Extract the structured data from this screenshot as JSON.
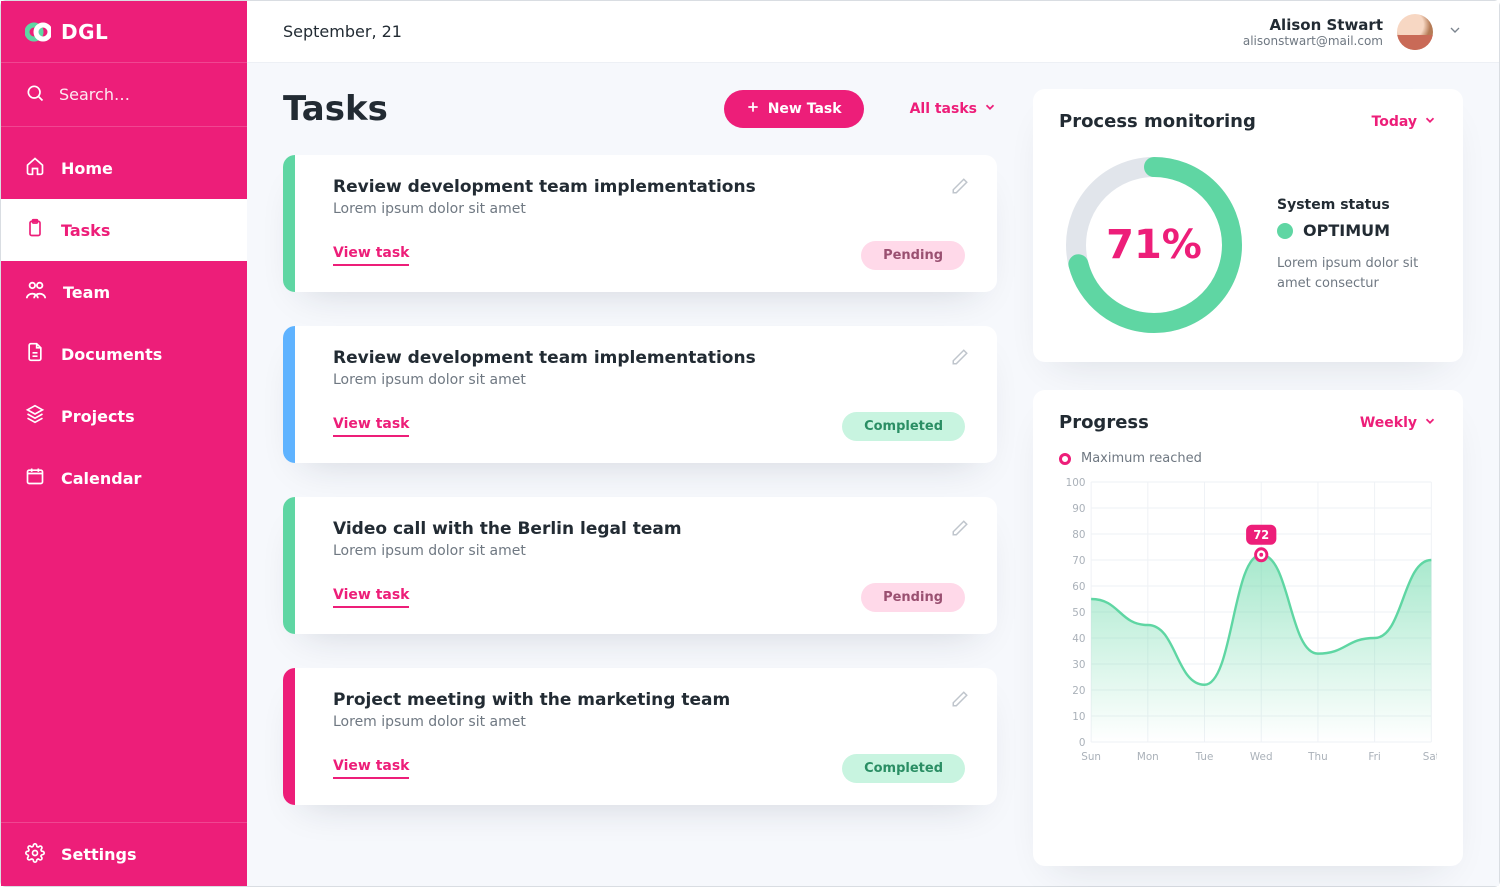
{
  "brand": {
    "name": "DGL"
  },
  "sidebar": {
    "search_placeholder": "Search…",
    "items": [
      {
        "id": "home",
        "label": "Home",
        "active": false
      },
      {
        "id": "tasks",
        "label": "Tasks",
        "active": true
      },
      {
        "id": "team",
        "label": "Team",
        "active": false
      },
      {
        "id": "documents",
        "label": "Documents",
        "active": false
      },
      {
        "id": "projects",
        "label": "Projects",
        "active": false
      },
      {
        "id": "calendar",
        "label": "Calendar",
        "active": false
      }
    ],
    "settings_label": "Settings"
  },
  "header": {
    "date": "September, 21",
    "user_name": "Alison Stwart",
    "user_email": "alisonstwart@mail.com"
  },
  "tasks": {
    "title": "Tasks",
    "new_task_label": "New Task",
    "filter_label": "All tasks",
    "view_label": "View task",
    "items": [
      {
        "stripe": "green",
        "title": "Review development team implementations",
        "subtitle": "Lorem ipsum dolor sit amet",
        "status": "Pending",
        "status_class": "pending"
      },
      {
        "stripe": "blue",
        "title": "Review development team implementations",
        "subtitle": "Lorem ipsum dolor sit amet",
        "status": "Completed",
        "status_class": "completed"
      },
      {
        "stripe": "green",
        "title": "Video call with the Berlin legal team",
        "subtitle": "Lorem ipsum dolor sit amet",
        "status": "Pending",
        "status_class": "pending"
      },
      {
        "stripe": "pink",
        "title": "Project meeting with the marketing team",
        "subtitle": "Lorem ipsum dolor sit amet",
        "status": "Completed",
        "status_class": "completed"
      }
    ]
  },
  "process": {
    "title": "Process monitoring",
    "filter_label": "Today",
    "percent_value": 71,
    "percent_text": "71%",
    "status_heading": "System status",
    "status_value": "OPTIMUM",
    "description": "Lorem ipsum dolor sit amet consectur"
  },
  "progress": {
    "title": "Progress",
    "filter_label": "Weekly",
    "legend_label": "Maximum reached",
    "peak_label": "72"
  },
  "chart_data": {
    "type": "area",
    "title": "Progress",
    "xlabel": "",
    "ylabel": "",
    "ylim": [
      0,
      100
    ],
    "y_ticks": [
      0,
      10,
      20,
      30,
      40,
      50,
      60,
      70,
      80,
      90,
      100
    ],
    "categories": [
      "Sun",
      "Mon",
      "Tue",
      "Wed",
      "Thu",
      "Fri",
      "Sat"
    ],
    "values": [
      55,
      45,
      22,
      72,
      34,
      40,
      70
    ],
    "peak": {
      "index": 3,
      "value": 72,
      "label": "72"
    },
    "legend": "Maximum reached"
  }
}
